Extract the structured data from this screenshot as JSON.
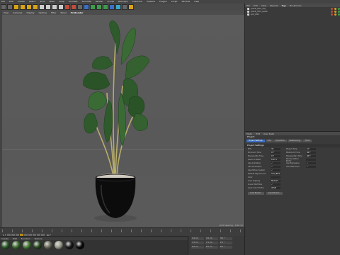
{
  "app": {
    "title": "Cinema 4D"
  },
  "menubar": [
    "File",
    "Edit",
    "Create",
    "Select",
    "Tools",
    "Mesh",
    "Snap",
    "Animate",
    "Simulate",
    "Render",
    "Sculpt",
    "MoGraph",
    "Character",
    "Pipeline",
    "Plugins",
    "Script",
    "Window",
    "Help"
  ],
  "viewport": {
    "menu": [
      "View",
      "Cameras",
      "Display",
      "Options",
      "Filter",
      "Panel",
      "ProRender"
    ],
    "active_menu": "ProRender",
    "status": "Grid Spacing : 100 cm"
  },
  "timeline": {
    "frame_readout": "0 F",
    "end_readout": "90 F"
  },
  "materials": {
    "menu": [
      "Create",
      "Edit",
      "Function",
      "Texture"
    ],
    "swatches": [
      "#2f5a2a",
      "#3c6b30",
      "#4a7a3a",
      "#2a4a22",
      "#6a6a5a",
      "#9a9a8a",
      "#1a1a1a",
      "#0a0a0a"
    ]
  },
  "coordinates": {
    "rows": [
      {
        "a": "X 0 cm",
        "b": "X 0 cm",
        "c": "H 0 °"
      },
      {
        "a": "Y 0 cm",
        "b": "Y 0 cm",
        "c": "P 0 °"
      },
      {
        "a": "Z 0 cm",
        "b": "Z 0 cm",
        "c": "B 0 °"
      }
    ]
  },
  "object_manager": {
    "tabs": [
      "File",
      "Edit",
      "View",
      "Objects",
      "Tags",
      "Bookmarks"
    ],
    "active_tab": "Tags",
    "objects": [
      "plant_001_obj",
      "plant_001_leafs",
      "pot_001"
    ]
  },
  "attributes": {
    "menu": [
      "Mode",
      "Edit",
      "User Data"
    ],
    "title": "Project",
    "tabs": [
      "Project Settings",
      "Info",
      "Dynamics",
      "Referencing",
      "To Do"
    ],
    "active_tab": "Project Settings",
    "section": "Project Settings",
    "fields": [
      {
        "label": "FPS",
        "value": "30",
        "label2": "Project Time",
        "value2": "0 F"
      },
      {
        "label": "Minimum Time",
        "value": "0 F",
        "label2": "Maximum Time",
        "value2": "90 F"
      },
      {
        "label": "Preview Min Time",
        "value": "0 F",
        "label2": "Preview Max Time",
        "value2": "90 F"
      },
      {
        "label": "Level of Detail",
        "value": "100 %",
        "label2": "Render LOD in Editor",
        "value2": ""
      },
      {
        "label": "Use Animation",
        "value": "✓",
        "label2": "Use Expression",
        "value2": "✓"
      },
      {
        "label": "Use Generators",
        "value": "✓",
        "label2": "Use Deformers",
        "value2": "✓"
      },
      {
        "label": "Use Motion System",
        "value": "✓",
        "label2": "",
        "value2": ""
      },
      {
        "label": "Default Object Color",
        "value": "Gray Blue",
        "label2": "",
        "value2": ""
      },
      {
        "label": "Color",
        "value": "",
        "label2": "",
        "value2": ""
      },
      {
        "label": "View Clipping",
        "value": "Medium",
        "label2": "",
        "value2": ""
      },
      {
        "label": "Linear Workflow",
        "value": "✓",
        "label2": "",
        "value2": ""
      },
      {
        "label": "Input Color Profile",
        "value": "sRGB",
        "label2": "",
        "value2": ""
      }
    ],
    "buttons": [
      "Load Preset...",
      "Save Preset..."
    ]
  }
}
